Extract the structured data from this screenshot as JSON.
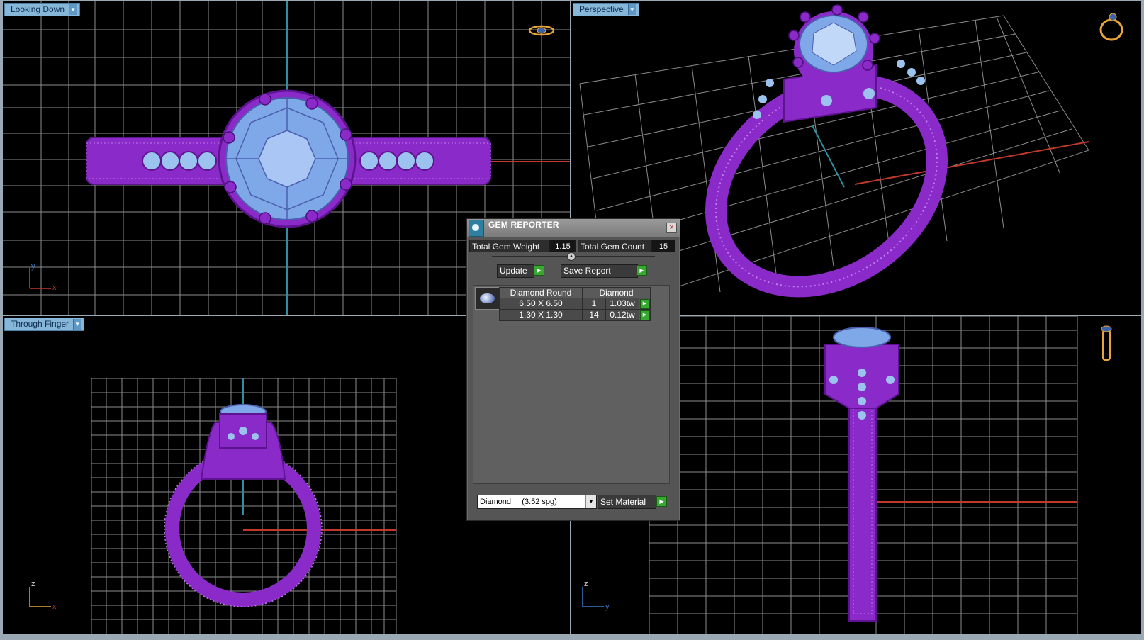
{
  "viewports": {
    "top_left": {
      "label": "Looking Down",
      "axis_x": "x",
      "axis_y": "y"
    },
    "top_right": {
      "label": "Perspective"
    },
    "bottom_left": {
      "label": "Through Finger",
      "axis_x": "x",
      "axis_y": "z"
    },
    "bottom_right": {
      "axis_x": "y",
      "axis_y": "z"
    }
  },
  "dialog": {
    "title": "GEM REPORTER",
    "close_glyph": "×",
    "total_weight_label": "Total Gem Weight",
    "total_weight_value": "1.15",
    "total_count_label": "Total Gem Count",
    "total_count_value": "15",
    "update_label": "Update",
    "save_report_label": "Save Report",
    "table": {
      "headers": [
        "Diamond Round",
        "Diamond"
      ],
      "rows": [
        {
          "size": "6.50 X 6.50",
          "count": "1",
          "weight": "1.03tw"
        },
        {
          "size": "1.30 X 1.30",
          "count": "14",
          "weight": "0.12tw"
        }
      ]
    },
    "material_select": "Diamond     (3.52 spg)",
    "set_material_label": "Set Material"
  },
  "colors": {
    "viewport_bg": "#000000",
    "grid": "#8c8c8c",
    "ring_metal": "#8a2bc9",
    "gem": "#7fa8e8",
    "axis_red": "#c0392b",
    "axis_cyan": "#2f8fa0",
    "label_bg": "#86b7d8"
  },
  "icons": [
    "dropdown-arrow-icon",
    "gem-reporter-app-icon",
    "close-icon",
    "play-arrow-icon",
    "ring-nav-icon",
    "axis-triad-icon"
  ]
}
